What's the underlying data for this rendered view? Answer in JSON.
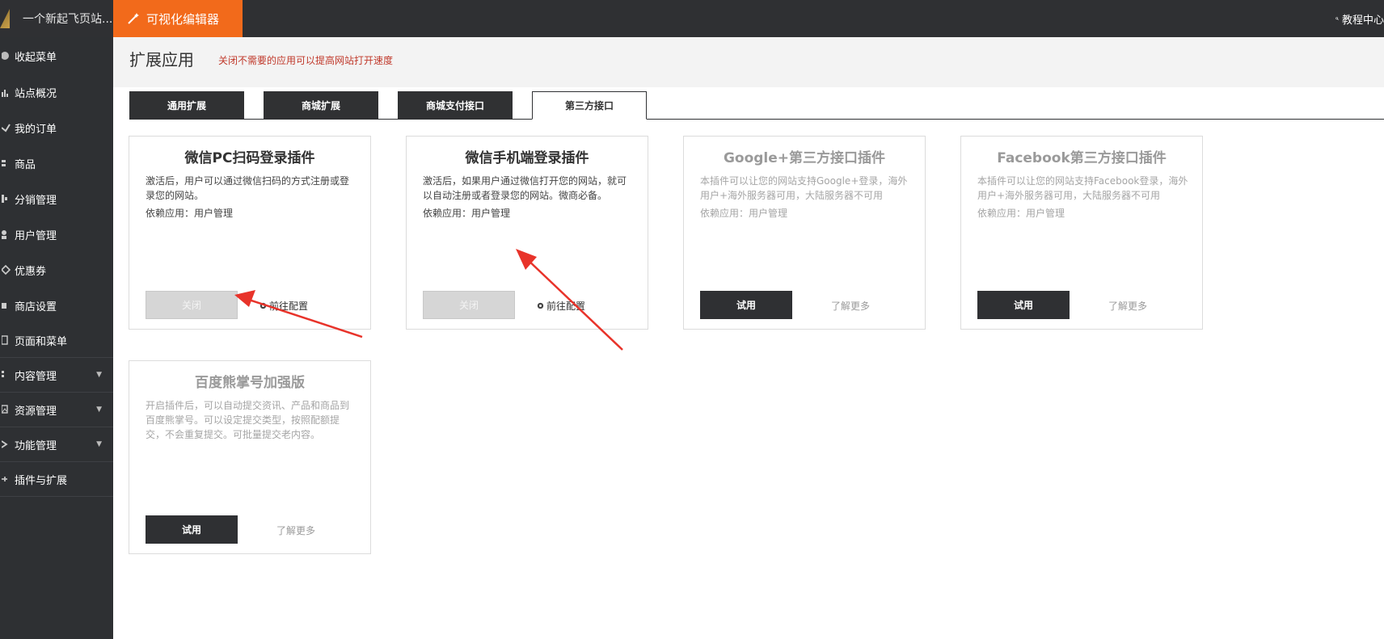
{
  "topbar": {
    "site_name": "一个新起飞页站...",
    "editor_label": "可视化编辑器",
    "tutorial_label": "教程中心"
  },
  "sidebar": {
    "items": [
      {
        "label": "收起菜单",
        "icon": "circle-icon"
      },
      {
        "label": "站点概况",
        "icon": "chart-icon"
      },
      {
        "label": "我的订单",
        "icon": "order-icon"
      },
      {
        "label": "商品",
        "icon": "product-icon"
      },
      {
        "label": "分销管理",
        "icon": "distribution-icon"
      },
      {
        "label": "用户管理",
        "icon": "user-icon"
      },
      {
        "label": "优惠券",
        "icon": "tag-icon"
      },
      {
        "label": "商店设置",
        "icon": "store-icon"
      },
      {
        "label": "页面和菜单",
        "icon": "page-icon"
      },
      {
        "label": "内容管理",
        "icon": "content-icon"
      },
      {
        "label": "资源管理",
        "icon": "image-icon"
      },
      {
        "label": "功能管理",
        "icon": "function-icon"
      },
      {
        "label": "插件与扩展",
        "icon": "plugin-icon"
      }
    ]
  },
  "header": {
    "title": "扩展应用",
    "hint": "关闭不需要的应用可以提高网站打开速度"
  },
  "tabs": [
    {
      "label": "通用扩展",
      "active": false
    },
    {
      "label": "商城扩展",
      "active": false
    },
    {
      "label": "商城支付接口",
      "active": false
    },
    {
      "label": "第三方接口",
      "active": true
    }
  ],
  "cards": [
    {
      "title": "微信PC扫码登录插件",
      "desc": "激活后，用户可以通过微信扫码的方式注册或登录您的网站。",
      "dep": "依赖应用：用户管理",
      "button": "关闭",
      "link": "前往配置"
    },
    {
      "title": "微信手机端登录插件",
      "desc": "激活后，如果用户通过微信打开您的网站，就可以自动注册或者登录您的网站。微商必备。",
      "dep": "依赖应用：用户管理",
      "button": "关闭",
      "link": "前往配置"
    },
    {
      "title": "Google+第三方接口插件",
      "desc": "本插件可以让您的网站支持Google+登录，海外用户+海外服务器可用，大陆服务器不可用",
      "dep": "依赖应用：用户管理",
      "button": "试用",
      "link": "了解更多"
    },
    {
      "title": "Facebook第三方接口插件",
      "desc": "本插件可以让您的网站支持Facebook登录，海外用户+海外服务器可用，大陆服务器不可用",
      "dep": "依赖应用：用户管理",
      "button": "试用",
      "link": "了解更多"
    },
    {
      "title": "百度熊掌号加强版",
      "desc": "开启插件后，可以自动提交资讯、产品和商品到百度熊掌号。可以设定提交类型，按照配额提交，不会重复提交。可批量提交老内容。",
      "button": "试用",
      "link": "了解更多"
    }
  ],
  "colors": {
    "topbar": "#2f3033",
    "accent": "#f26a1b",
    "hint": "#c0392b",
    "annotation_arrow": "#e8332a"
  }
}
